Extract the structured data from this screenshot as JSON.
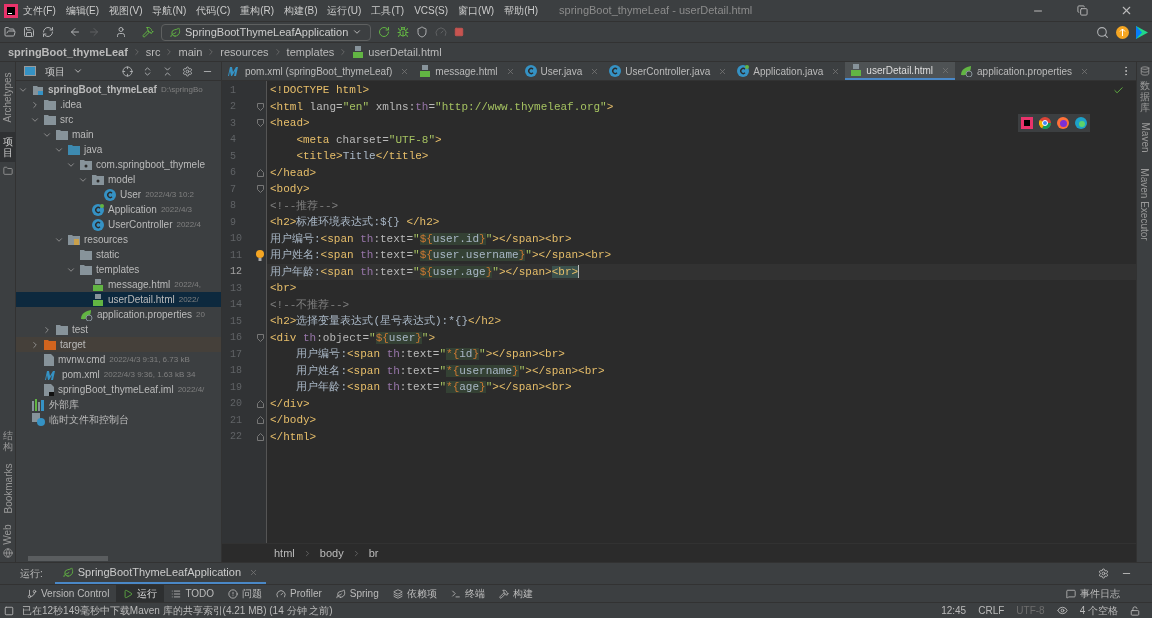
{
  "window": {
    "title": "springBoot_thymeLeaf - userDetail.html"
  },
  "menu": [
    "文件(F)",
    "编辑(E)",
    "视图(V)",
    "导航(N)",
    "代码(C)",
    "重构(R)",
    "构建(B)",
    "运行(U)",
    "工具(T)",
    "VCS(S)",
    "窗口(W)",
    "帮助(H)"
  ],
  "toolbar": {
    "run_config": "SpringBootThymeLeafApplication"
  },
  "breadcrumb": [
    "springBoot_thymeLeaf",
    "src",
    "main",
    "resources",
    "templates",
    "userDetail.html"
  ],
  "left_strip": {
    "top": [
      {
        "label": "Archetypes",
        "kind": "rotated",
        "selected": false
      },
      {
        "label": "项目",
        "kind": "vertical",
        "selected": true
      }
    ],
    "bottom": [
      {
        "label": "结构",
        "kind": "vertical",
        "selected": false
      },
      {
        "label": "Bookmarks",
        "kind": "rotated",
        "selected": false
      },
      {
        "label": "Web",
        "kind": "rotated",
        "selected": false
      }
    ]
  },
  "right_strip": [
    {
      "label": "数据库",
      "kind": "vertical"
    },
    {
      "label": "Maven",
      "kind": "rotated"
    },
    {
      "label": "Maven Executor",
      "kind": "rotated"
    }
  ],
  "project": {
    "title": "项目",
    "tree": [
      {
        "name": "springBoot_thymeLeaf",
        "kind": "module",
        "meta": "D:\\springBo",
        "expanded": true,
        "selected": false,
        "children": [
          {
            "name": ".idea",
            "kind": "folder",
            "expanded": false,
            "selected": false
          },
          {
            "name": "src",
            "kind": "folder",
            "expanded": true,
            "selected": false,
            "children": [
              {
                "name": "main",
                "kind": "folder",
                "expanded": true,
                "selected": false,
                "children": [
                  {
                    "name": "java",
                    "kind": "source-folder",
                    "expanded": true,
                    "selected": false,
                    "children": [
                      {
                        "name": "com.springboot_thymele",
                        "kind": "package",
                        "expanded": true,
                        "selected": false,
                        "children": [
                          {
                            "name": "model",
                            "kind": "package",
                            "expanded": true,
                            "selected": false,
                            "children": [
                              {
                                "name": "User",
                                "kind": "class",
                                "meta": "2022/4/3 10:2",
                                "selected": false
                              }
                            ]
                          },
                          {
                            "name": "Application",
                            "kind": "app-class",
                            "meta": "2022/4/3",
                            "selected": false
                          },
                          {
                            "name": "UserController",
                            "kind": "class",
                            "meta": "2022/4",
                            "selected": false
                          }
                        ]
                      }
                    ]
                  },
                  {
                    "name": "resources",
                    "kind": "resources-folder",
                    "expanded": true,
                    "selected": false,
                    "children": [
                      {
                        "name": "static",
                        "kind": "folder",
                        "selected": false
                      },
                      {
                        "name": "templates",
                        "kind": "folder",
                        "expanded": true,
                        "selected": false,
                        "children": [
                          {
                            "name": "message.html",
                            "kind": "html",
                            "meta": "2022/4,",
                            "selected": false
                          },
                          {
                            "name": "userDetail.html",
                            "kind": "html",
                            "meta": "2022/",
                            "selected": true
                          }
                        ]
                      },
                      {
                        "name": "application.properties",
                        "kind": "properties",
                        "meta": "20",
                        "selected": false
                      }
                    ]
                  }
                ]
              },
              {
                "name": "test",
                "kind": "folder",
                "expanded": false,
                "selected": false
              }
            ]
          },
          {
            "name": "target",
            "kind": "excluded-folder",
            "expanded": false,
            "selected": false
          },
          {
            "name": "mvnw.cmd",
            "kind": "file",
            "meta": "2022/4/3 9:31, 6.73 kB",
            "selected": false
          },
          {
            "name": "pom.xml",
            "kind": "maven",
            "meta": "2022/4/3 9:36, 1.63 kB 34",
            "selected": false
          },
          {
            "name": "springBoot_thymeLeaf.iml",
            "kind": "iml",
            "meta": "2022/4/",
            "selected": false
          }
        ]
      },
      {
        "name": "外部库",
        "kind": "library",
        "selected": false
      },
      {
        "name": "临时文件和控制台",
        "kind": "scratches",
        "selected": false
      }
    ]
  },
  "tabs": [
    {
      "label": "pom.xml (springBoot_thymeLeaf)",
      "kind": "maven",
      "selected": false
    },
    {
      "label": "message.html",
      "kind": "html",
      "selected": false
    },
    {
      "label": "User.java",
      "kind": "class",
      "selected": false
    },
    {
      "label": "UserController.java",
      "kind": "class",
      "selected": false
    },
    {
      "label": "Application.java",
      "kind": "app-class",
      "selected": false
    },
    {
      "label": "userDetail.html",
      "kind": "html",
      "selected": true
    },
    {
      "label": "application.properties",
      "kind": "properties",
      "selected": false
    }
  ],
  "code": [
    {
      "n": "1",
      "current": false,
      "seg": [
        {
          "t": "<!DOCTYPE html>",
          "kind": "tag"
        }
      ]
    },
    {
      "n": "2",
      "current": false,
      "fold": {
        "kind": "start"
      },
      "seg": [
        {
          "t": "<html",
          "kind": "tag"
        },
        {
          "t": " lang=",
          "kind": "attr"
        },
        {
          "t": "\"en\"",
          "kind": "str"
        },
        {
          "t": " xmlns:",
          "kind": "attr"
        },
        {
          "t": "th",
          "kind": "ns"
        },
        {
          "t": "=",
          "kind": "attr"
        },
        {
          "t": "\"http://www.thymeleaf.org\"",
          "kind": "str"
        },
        {
          "t": ">",
          "kind": "tag"
        }
      ]
    },
    {
      "n": "3",
      "current": false,
      "fold": {
        "kind": "start"
      },
      "seg": [
        {
          "t": "<head>",
          "kind": "tag"
        }
      ]
    },
    {
      "n": "4",
      "current": false,
      "seg": [
        {
          "t": "    <meta",
          "kind": "tag"
        },
        {
          "t": " charset=",
          "kind": "attr"
        },
        {
          "t": "\"UTF-8\"",
          "kind": "str"
        },
        {
          "t": ">",
          "kind": "tag"
        }
      ]
    },
    {
      "n": "5",
      "current": false,
      "seg": [
        {
          "t": "    <title>",
          "kind": "tag"
        },
        {
          "t": "Title",
          "kind": "text"
        },
        {
          "t": "</title>",
          "kind": "tag"
        }
      ]
    },
    {
      "n": "6",
      "current": false,
      "fold": {
        "kind": "end"
      },
      "seg": [
        {
          "t": "</head>",
          "kind": "tag"
        }
      ]
    },
    {
      "n": "7",
      "current": false,
      "fold": {
        "kind": "start"
      },
      "seg": [
        {
          "t": "<body>",
          "kind": "tag"
        }
      ]
    },
    {
      "n": "8",
      "current": false,
      "seg": [
        {
          "t": "<!--推荐-->",
          "kind": "comment"
        }
      ]
    },
    {
      "n": "9",
      "current": false,
      "seg": [
        {
          "t": "<h2>",
          "kind": "tag"
        },
        {
          "t": "标准环境表达式:${} ",
          "kind": "text"
        },
        {
          "t": "</h2>",
          "kind": "tag"
        }
      ]
    },
    {
      "n": "10",
      "current": false,
      "seg": [
        {
          "t": "用户编号:",
          "kind": "text"
        },
        {
          "t": "<span ",
          "kind": "tag"
        },
        {
          "t": "th",
          "kind": "ns"
        },
        {
          "t": ":text=",
          "kind": "attr"
        },
        {
          "t": "\"",
          "kind": "str"
        },
        {
          "t": "${",
          "kind": "expr-op"
        },
        {
          "t": "user.id",
          "kind": "expr"
        },
        {
          "t": "}",
          "kind": "expr-op"
        },
        {
          "t": "\"",
          "kind": "str"
        },
        {
          "t": "></span><br>",
          "kind": "tag"
        }
      ]
    },
    {
      "n": "11",
      "current": false,
      "bulb": true,
      "seg": [
        {
          "t": "用户姓名:",
          "kind": "text"
        },
        {
          "t": "<span ",
          "kind": "tag"
        },
        {
          "t": "th",
          "kind": "ns"
        },
        {
          "t": ":text=",
          "kind": "attr"
        },
        {
          "t": "\"",
          "kind": "str"
        },
        {
          "t": "${",
          "kind": "expr-op"
        },
        {
          "t": "user.username",
          "kind": "expr"
        },
        {
          "t": "}",
          "kind": "expr-op"
        },
        {
          "t": "\"",
          "kind": "str"
        },
        {
          "t": "></span><br>",
          "kind": "tag"
        }
      ]
    },
    {
      "n": "12",
      "current": true,
      "seg": [
        {
          "t": "用户年龄:",
          "kind": "text"
        },
        {
          "t": "<span ",
          "kind": "tag"
        },
        {
          "t": "th",
          "kind": "ns"
        },
        {
          "t": ":text=",
          "kind": "attr"
        },
        {
          "t": "\"",
          "kind": "str"
        },
        {
          "t": "${",
          "kind": "expr-op"
        },
        {
          "t": "user.age",
          "kind": "expr"
        },
        {
          "t": "}",
          "kind": "expr-op"
        },
        {
          "t": "\"",
          "kind": "str"
        },
        {
          "t": "></span>",
          "kind": "tag"
        },
        {
          "t": "<br>",
          "kind": "tag-match"
        }
      ]
    },
    {
      "n": "13",
      "current": false,
      "seg": [
        {
          "t": "<br>",
          "kind": "tag"
        }
      ]
    },
    {
      "n": "14",
      "current": false,
      "seg": [
        {
          "t": "<!--不推荐-->",
          "kind": "comment"
        }
      ]
    },
    {
      "n": "15",
      "current": false,
      "seg": [
        {
          "t": "<h2>",
          "kind": "tag"
        },
        {
          "t": "选择变量表达式(星号表达式):*{}",
          "kind": "text"
        },
        {
          "t": "</h2>",
          "kind": "tag"
        }
      ]
    },
    {
      "n": "16",
      "current": false,
      "fold": {
        "kind": "start"
      },
      "seg": [
        {
          "t": "<div ",
          "kind": "tag"
        },
        {
          "t": "th",
          "kind": "ns"
        },
        {
          "t": ":object=",
          "kind": "attr"
        },
        {
          "t": "\"",
          "kind": "str"
        },
        {
          "t": "${",
          "kind": "expr-op"
        },
        {
          "t": "user",
          "kind": "expr"
        },
        {
          "t": "}",
          "kind": "expr-op"
        },
        {
          "t": "\"",
          "kind": "str"
        },
        {
          "t": ">",
          "kind": "tag"
        }
      ]
    },
    {
      "n": "17",
      "current": false,
      "seg": [
        {
          "t": "    用户编号:",
          "kind": "text"
        },
        {
          "t": "<span ",
          "kind": "tag"
        },
        {
          "t": "th",
          "kind": "ns"
        },
        {
          "t": ":text=",
          "kind": "attr"
        },
        {
          "t": "\"",
          "kind": "str"
        },
        {
          "t": "*{",
          "kind": "expr-op"
        },
        {
          "t": "id",
          "kind": "expr"
        },
        {
          "t": "}",
          "kind": "expr-op"
        },
        {
          "t": "\"",
          "kind": "str"
        },
        {
          "t": "></span><br>",
          "kind": "tag"
        }
      ]
    },
    {
      "n": "18",
      "current": false,
      "seg": [
        {
          "t": "    用户姓名:",
          "kind": "text"
        },
        {
          "t": "<span ",
          "kind": "tag"
        },
        {
          "t": "th",
          "kind": "ns"
        },
        {
          "t": ":text=",
          "kind": "attr"
        },
        {
          "t": "\"",
          "kind": "str"
        },
        {
          "t": "*{",
          "kind": "expr-op"
        },
        {
          "t": "username",
          "kind": "expr"
        },
        {
          "t": "}",
          "kind": "expr-op"
        },
        {
          "t": "\"",
          "kind": "str"
        },
        {
          "t": "></span><br>",
          "kind": "tag"
        }
      ]
    },
    {
      "n": "19",
      "current": false,
      "seg": [
        {
          "t": "    用户年龄:",
          "kind": "text"
        },
        {
          "t": "<span ",
          "kind": "tag"
        },
        {
          "t": "th",
          "kind": "ns"
        },
        {
          "t": ":text=",
          "kind": "attr"
        },
        {
          "t": "\"",
          "kind": "str"
        },
        {
          "t": "*{",
          "kind": "expr-op"
        },
        {
          "t": "age",
          "kind": "expr"
        },
        {
          "t": "}",
          "kind": "expr-op"
        },
        {
          "t": "\"",
          "kind": "str"
        },
        {
          "t": "></span><br>",
          "kind": "tag"
        }
      ]
    },
    {
      "n": "20",
      "current": false,
      "fold": {
        "kind": "end"
      },
      "seg": [
        {
          "t": "</div>",
          "kind": "tag"
        }
      ]
    },
    {
      "n": "21",
      "current": false,
      "fold": {
        "kind": "end"
      },
      "seg": [
        {
          "t": "</body>",
          "kind": "tag"
        }
      ]
    },
    {
      "n": "22",
      "current": false,
      "fold": {
        "kind": "end"
      },
      "seg": [
        {
          "t": "</html>",
          "kind": "tag"
        }
      ]
    }
  ],
  "editor_breadcrumb": [
    "html",
    "body",
    "br"
  ],
  "run_panel": {
    "label": "运行:",
    "tab": "SpringBootThymeLeafApplication"
  },
  "tool_tabs": [
    {
      "label": "Version Control",
      "kind": "vcs",
      "selected": false
    },
    {
      "label": "运行",
      "kind": "run",
      "selected": true
    },
    {
      "label": "TODO",
      "kind": "todo",
      "selected": false
    },
    {
      "label": "问题",
      "kind": "problems",
      "selected": false
    },
    {
      "label": "Profiler",
      "kind": "profiler",
      "selected": false
    },
    {
      "label": "Spring",
      "kind": "spring",
      "selected": false
    },
    {
      "label": "依赖项",
      "kind": "deps",
      "selected": false
    },
    {
      "label": "终端",
      "kind": "terminal",
      "selected": false
    },
    {
      "label": "构建",
      "kind": "build",
      "selected": false
    }
  ],
  "event_log": "事件日志",
  "status": {
    "message": "已在12秒149毫秒中下载Maven 库的共享索引(4.21 MB) (14 分钟 之前)",
    "items": [
      {
        "label": "12:45",
        "disabled": false
      },
      {
        "label": "CRLF",
        "disabled": false
      },
      {
        "label": "UTF-8",
        "disabled": true
      },
      {
        "label": "4 个空格",
        "disabled": false,
        "kind": "indent"
      }
    ]
  }
}
